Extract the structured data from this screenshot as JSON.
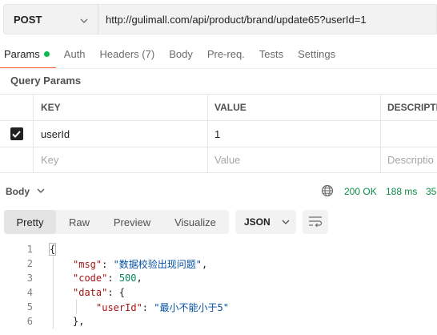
{
  "request": {
    "method": "POST",
    "url": "http://gulimall.com/api/product/brand/update65?userId=1"
  },
  "tabs": [
    {
      "label": "Params",
      "active": true,
      "indicator_color": "#0cbb52"
    },
    {
      "label": "Auth",
      "active": false
    },
    {
      "label": "Headers (7)",
      "active": false
    },
    {
      "label": "Body",
      "active": false
    },
    {
      "label": "Pre-req.",
      "active": false
    },
    {
      "label": "Tests",
      "active": false
    },
    {
      "label": "Settings",
      "active": false
    }
  ],
  "query_params": {
    "title": "Query Params",
    "columns": [
      "KEY",
      "VALUE",
      "DESCRIPTI"
    ],
    "rows": [
      {
        "checked": true,
        "key": "userId",
        "value": "1",
        "description": ""
      }
    ],
    "placeholders": {
      "key": "Key",
      "value": "Value",
      "description": "Descriptio"
    }
  },
  "response": {
    "section_label": "Body",
    "status": "200 OK",
    "time": "188 ms",
    "size": "35",
    "status_color": "#0c8c47",
    "view_modes": [
      "Pretty",
      "Raw",
      "Preview",
      "Visualize"
    ],
    "active_view": "Pretty",
    "format": "JSON",
    "wrap_icon": "wrap-lines-icon",
    "lines": [
      {
        "n": "1",
        "indent": 0,
        "parts": [
          {
            "t": "{",
            "c": "pun",
            "box": true
          }
        ]
      },
      {
        "n": "2",
        "indent": 1,
        "parts": [
          {
            "t": "\"msg\"",
            "c": "key"
          },
          {
            "t": ": ",
            "c": "pun"
          },
          {
            "t": "\"数据校验出现问题\"",
            "c": "str"
          },
          {
            "t": ",",
            "c": "pun"
          }
        ]
      },
      {
        "n": "3",
        "indent": 1,
        "parts": [
          {
            "t": "\"code\"",
            "c": "key"
          },
          {
            "t": ": ",
            "c": "pun"
          },
          {
            "t": "500",
            "c": "num"
          },
          {
            "t": ",",
            "c": "pun"
          }
        ]
      },
      {
        "n": "4",
        "indent": 1,
        "parts": [
          {
            "t": "\"data\"",
            "c": "key"
          },
          {
            "t": ": {",
            "c": "pun"
          }
        ]
      },
      {
        "n": "5",
        "indent": 2,
        "parts": [
          {
            "t": "\"userId\"",
            "c": "key"
          },
          {
            "t": ": ",
            "c": "pun"
          },
          {
            "t": "\"最小不能小于5\"",
            "c": "str"
          }
        ]
      },
      {
        "n": "6",
        "indent": 1,
        "parts": [
          {
            "t": "},",
            "c": "pun"
          }
        ]
      }
    ]
  }
}
